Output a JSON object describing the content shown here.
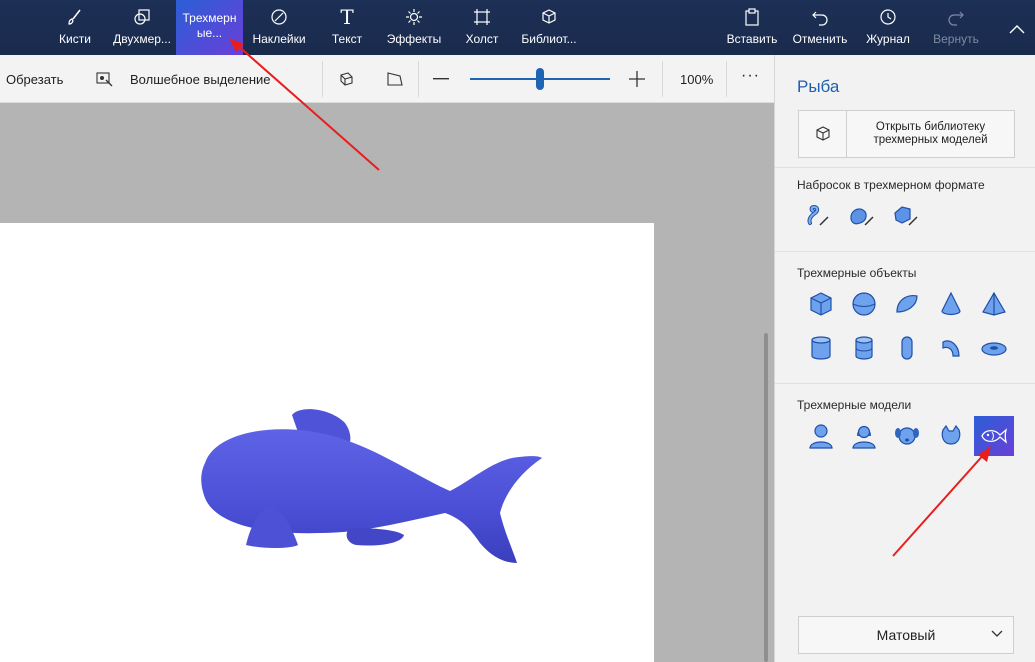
{
  "ribbon": {
    "items": [
      {
        "label": "Кисти",
        "icon": "brush-icon"
      },
      {
        "label": "Двухмер...",
        "icon": "shapes-2d-icon"
      },
      {
        "label": "Трехмерн ые...",
        "icon": "shapes-3d-icon"
      },
      {
        "label": "Наклейки",
        "icon": "stickers-icon"
      },
      {
        "label": "Текст",
        "icon": "text-icon"
      },
      {
        "label": "Эффекты",
        "icon": "effects-icon"
      },
      {
        "label": "Холст",
        "icon": "canvas-icon"
      },
      {
        "label": "Библиот...",
        "icon": "library-icon"
      }
    ],
    "right": [
      {
        "label": "Вставить",
        "icon": "paste-icon"
      },
      {
        "label": "Отменить",
        "icon": "undo-icon"
      },
      {
        "label": "Журнал",
        "icon": "history-icon"
      },
      {
        "label": "Вернуть",
        "icon": "redo-icon"
      }
    ],
    "active_line1": "Трехмерн",
    "active_line2": "ые..."
  },
  "toolbar": {
    "crop": "Обрезать",
    "magic_select": "Волшебное выделение",
    "zoom_value": "100%",
    "zoom_fraction": 0.5,
    "more": "···"
  },
  "panel": {
    "title": "Рыба",
    "library_button": "Открыть библиотеку трехмерных моделей",
    "sketch_title": "Набросок в трехмерном формате",
    "objects_title": "Трехмерные объекты",
    "models_title": "Трехмерные модели",
    "material": "Матовый"
  },
  "colors": {
    "ribbon_bg": "#1c2f55",
    "accent": "#1e64b4",
    "selection_gradient": "#2b5fd6",
    "fish": "#4a4fd6",
    "arrow": "#e81e1e"
  }
}
